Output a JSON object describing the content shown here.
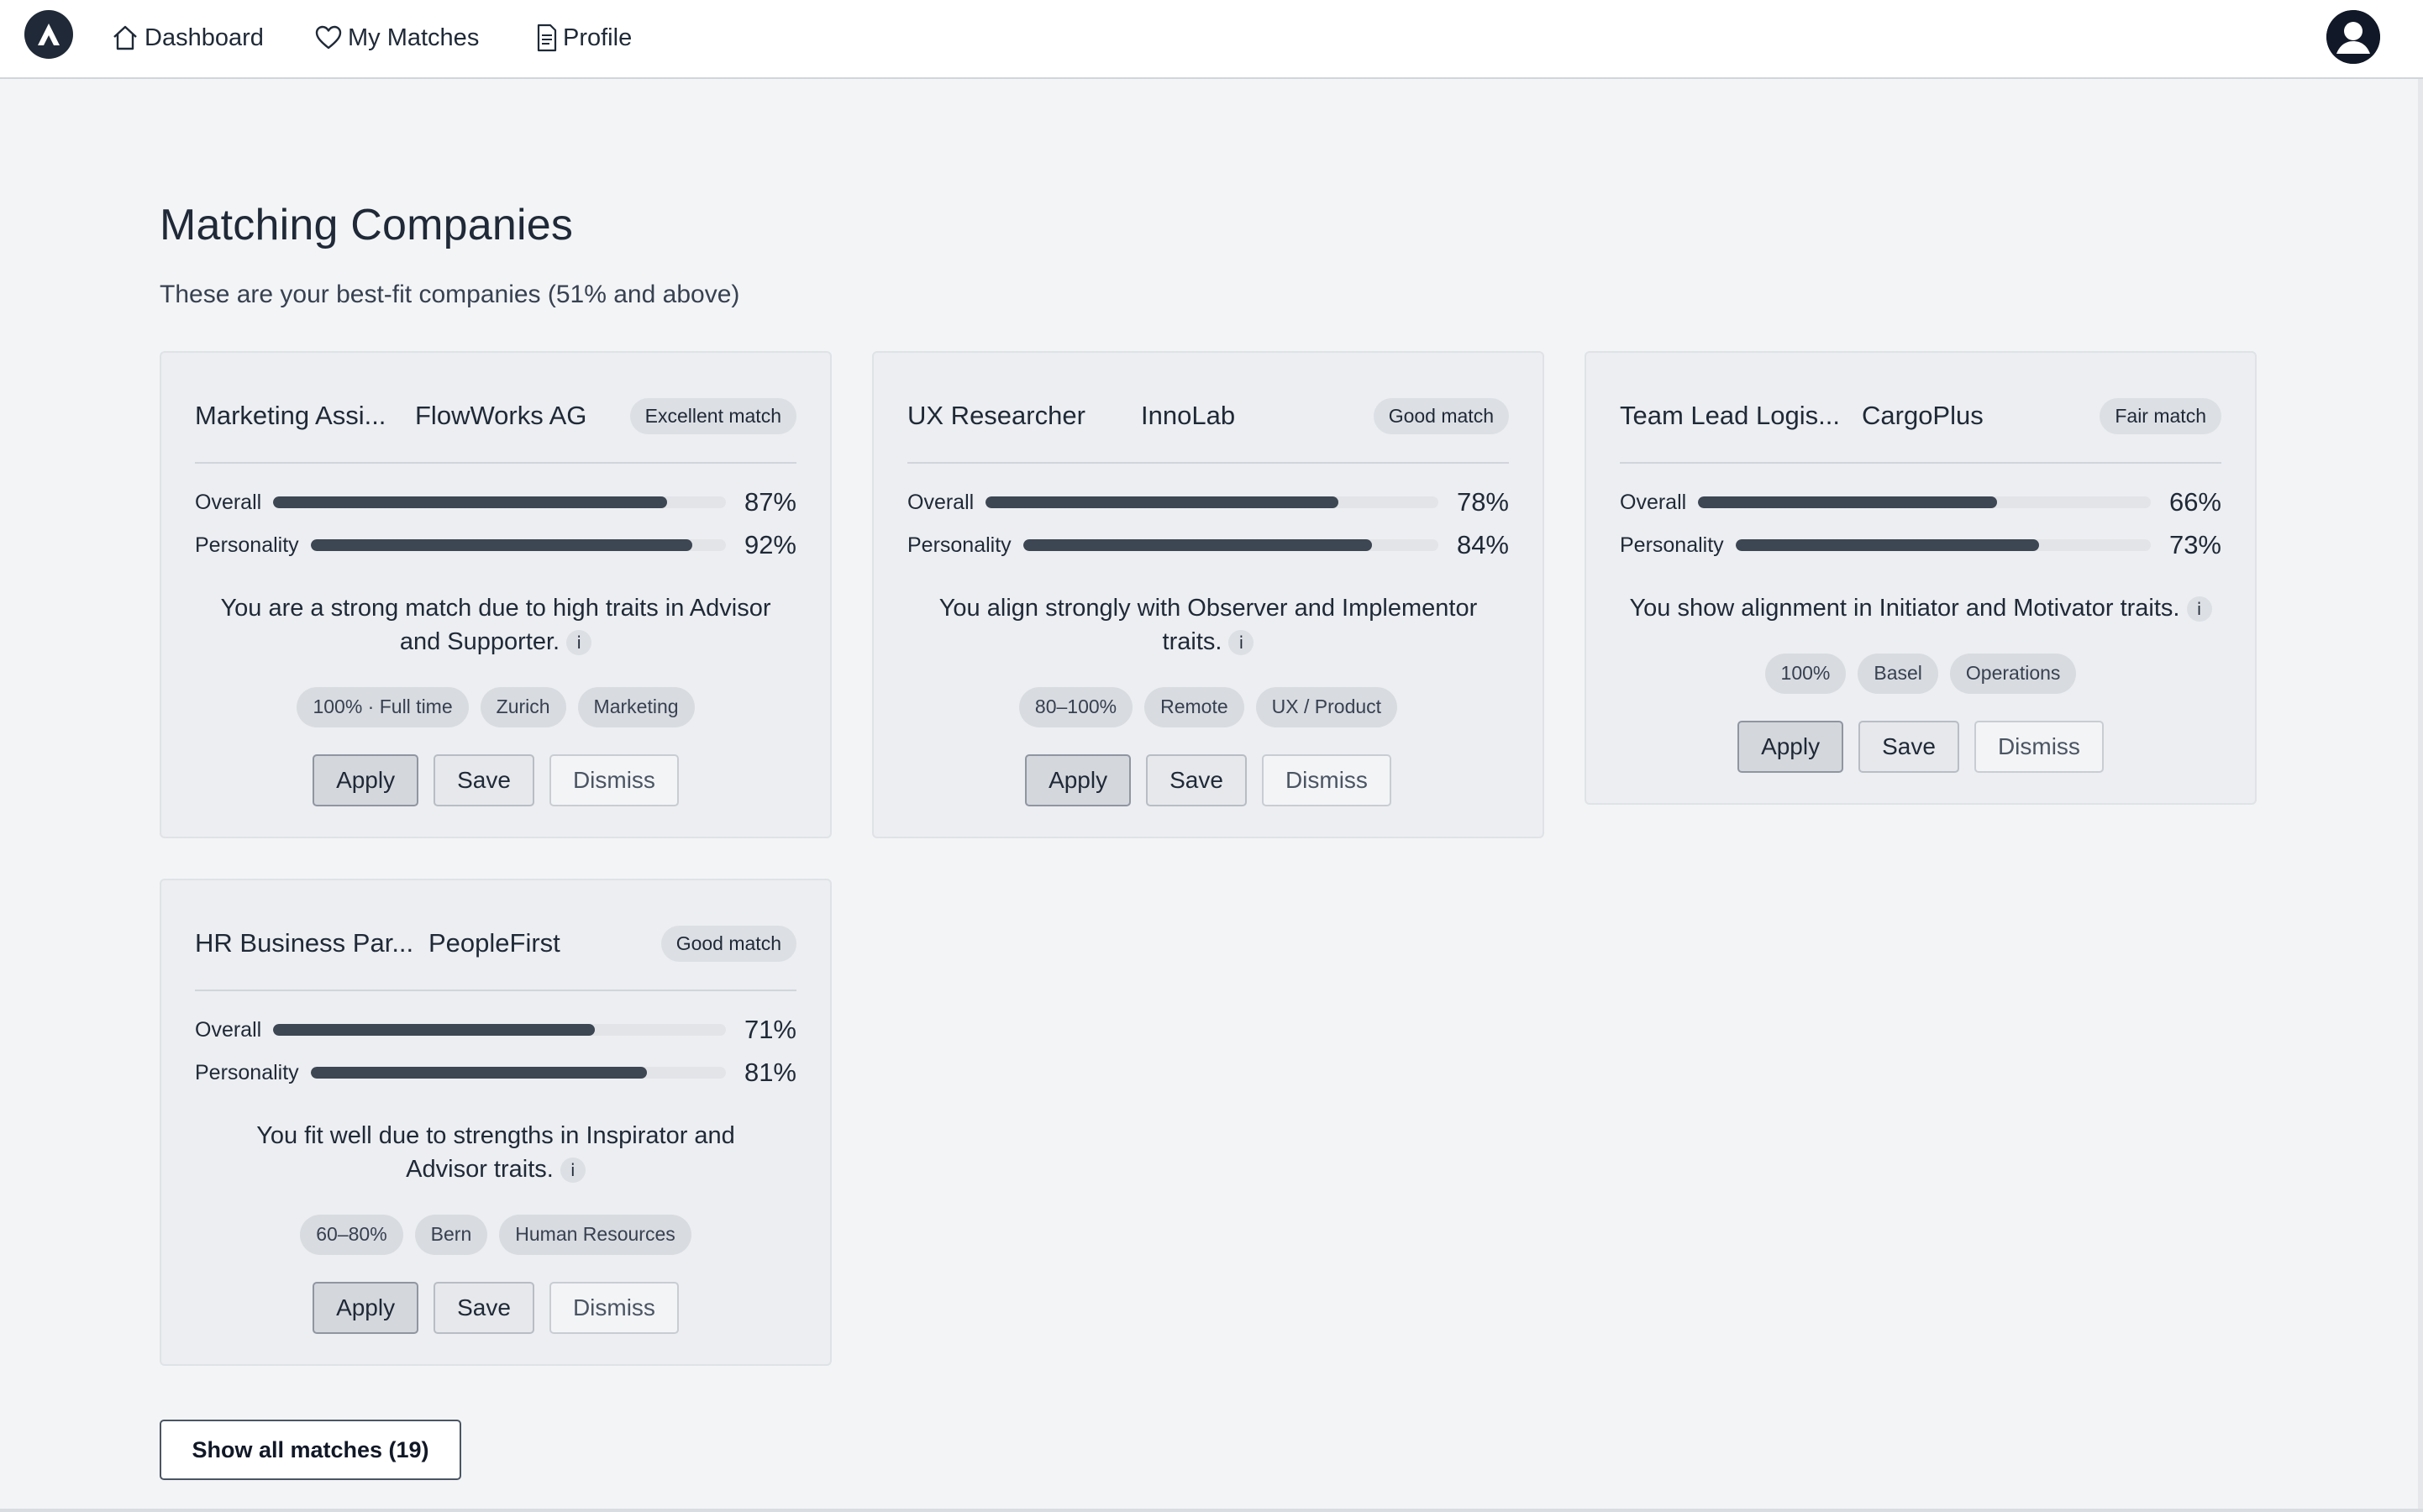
{
  "nav": {
    "items": [
      {
        "label": "Dashboard",
        "icon": "home-icon"
      },
      {
        "label": "My Matches",
        "icon": "heart-icon"
      },
      {
        "label": "Profile",
        "icon": "document-icon"
      }
    ]
  },
  "header": {
    "title": "Matching Companies",
    "subtitle": "These are your best-fit companies (51% and above)"
  },
  "colors": {
    "bar_fill": "#3d4653",
    "bar_track": "#e2e4e8",
    "card_bg": "#eceef1"
  },
  "cards": [
    {
      "role": "Marketing Assi...",
      "company": "FlowWorks AG",
      "badge": "Excellent match",
      "overall_label": "Overall",
      "overall_value": "87%",
      "overall_fraction": 0.87,
      "personality_label": "Personality",
      "personality_value": "92%",
      "personality_fraction": 0.92,
      "explanation": "You are a strong match due to high traits in Advisor and Supporter.",
      "info": "i",
      "chips": [
        "100% · Full time",
        "Zurich",
        "Marketing"
      ],
      "apply": "Apply",
      "save": "Save",
      "dismiss": "Dismiss"
    },
    {
      "role": "UX Researcher",
      "company": "InnoLab",
      "badge": "Good match",
      "overall_label": "Overall",
      "overall_value": "78%",
      "overall_fraction": 0.78,
      "personality_label": "Personality",
      "personality_value": "84%",
      "personality_fraction": 0.84,
      "explanation": "You align strongly with Observer and Implementor traits.",
      "info": "i",
      "chips": [
        "80–100%",
        "Remote",
        "UX / Product"
      ],
      "apply": "Apply",
      "save": "Save",
      "dismiss": "Dismiss"
    },
    {
      "role": "Team Lead Logis...",
      "company": "CargoPlus",
      "badge": "Fair match",
      "overall_label": "Overall",
      "overall_value": "66%",
      "overall_fraction": 0.66,
      "personality_label": "Personality",
      "personality_value": "73%",
      "personality_fraction": 0.73,
      "explanation": "You show alignment in Initiator and Motivator traits.",
      "info": "i",
      "chips": [
        "100%",
        "Basel",
        "Operations"
      ],
      "apply": "Apply",
      "save": "Save",
      "dismiss": "Dismiss"
    },
    {
      "role": "HR Business Par...",
      "company": "PeopleFirst",
      "badge": "Good match",
      "overall_label": "Overall",
      "overall_value": "71%",
      "overall_fraction": 0.71,
      "personality_label": "Personality",
      "personality_value": "81%",
      "personality_fraction": 0.81,
      "explanation": "You fit well due to strengths in Inspirator and Advisor traits.",
      "info": "i",
      "chips": [
        "60–80%",
        "Bern",
        "Human Resources"
      ],
      "apply": "Apply",
      "save": "Save",
      "dismiss": "Dismiss"
    }
  ],
  "footer": {
    "show_all_label": "Show all matches (19)"
  }
}
